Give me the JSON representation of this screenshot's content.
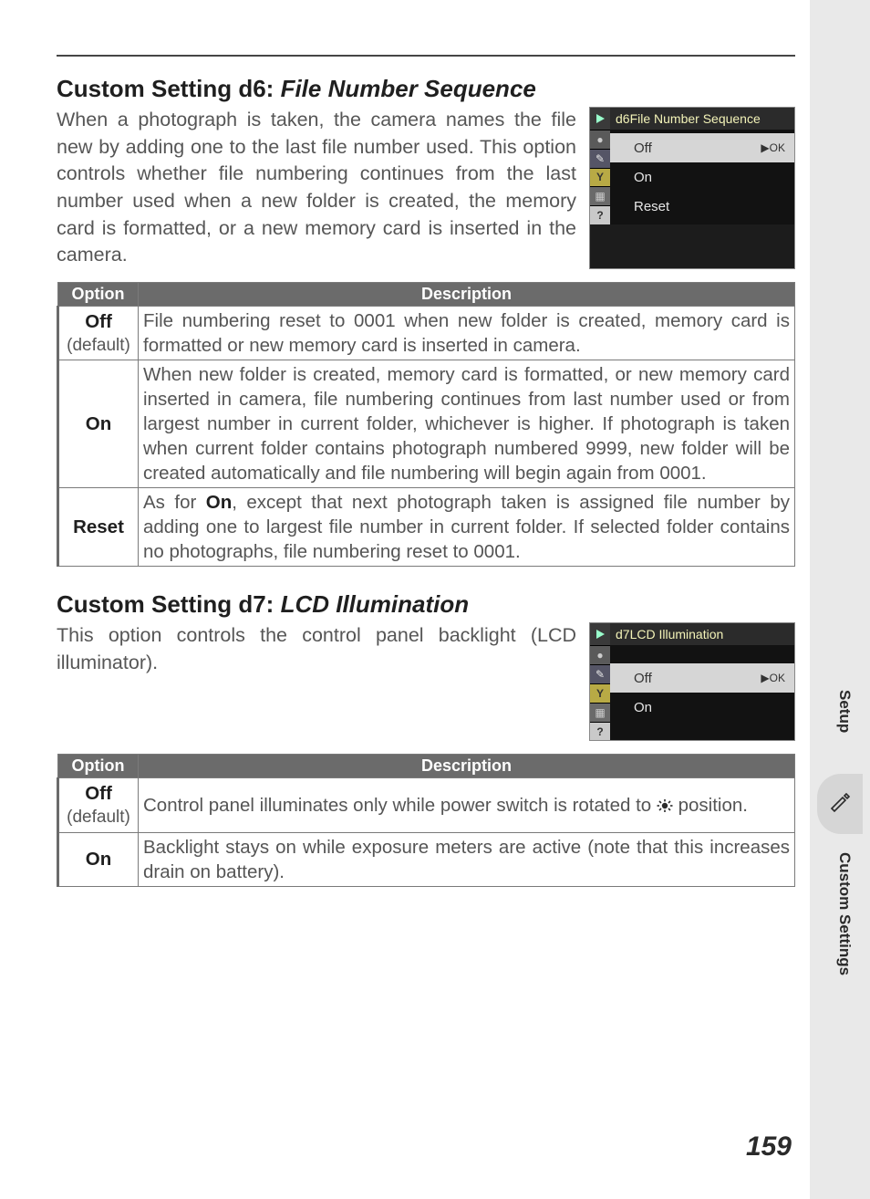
{
  "page_number": "159",
  "sidebar": {
    "setup_label": "Setup",
    "custom_label": "Custom Settings"
  },
  "d6": {
    "heading_prefix": "Custom Setting d6: ",
    "heading_italic": "File Number Sequence",
    "intro": "When a photograph is taken, the camera names the file new by adding one to the last file number used.  This option controls whether file numbering continues from the last number used when a new folder is created, the memory card is formatted, or a new memory card is inserted in the camera.",
    "lcd": {
      "title": "d6File Number Sequence",
      "rows": [
        {
          "label": "Off",
          "ok": "▶OK",
          "selected": true
        },
        {
          "label": "On",
          "selected": false
        },
        {
          "label": "Reset",
          "selected": false
        }
      ],
      "side_icons": [
        "●",
        "✎",
        "Y",
        "▦",
        "?"
      ]
    },
    "table": {
      "headers": {
        "option": "Option",
        "description": "Description"
      },
      "rows": [
        {
          "option": "Off",
          "sub": "(default)",
          "desc": "File numbering reset to 0001 when new folder is created, memory card is formatted or new memory card is inserted in camera."
        },
        {
          "option": "On",
          "desc": "When new folder is created, memory card is formatted, or new memory card inserted in camera, file numbering continues from last number used or from largest number in current folder, whichever is higher.  If photograph is taken when current folder contains photograph numbered 9999, new folder will be created automatically and file numbering will begin again from 0001."
        },
        {
          "option": "Reset",
          "desc_pre": "As for ",
          "desc_bold": "On",
          "desc_post": ", except that next photograph taken is assigned file number by adding one to largest file number in current folder.  If selected folder contains no photographs, file numbering reset to 0001."
        }
      ]
    }
  },
  "d7": {
    "heading_prefix": "Custom Setting d7: ",
    "heading_italic": "LCD Illumination",
    "intro": "This option controls the control panel backlight (LCD illuminator).",
    "lcd": {
      "title": "d7LCD Illumination",
      "rows": [
        {
          "label": "Off",
          "ok": "▶OK",
          "selected": true
        },
        {
          "label": "On",
          "selected": false
        }
      ],
      "side_icons": [
        "●",
        "✎",
        "Y",
        "▦",
        "?"
      ]
    },
    "table": {
      "headers": {
        "option": "Option",
        "description": "Description"
      },
      "rows": [
        {
          "option": "Off",
          "sub": "(default)",
          "desc_pre": "Control panel illuminates only while power switch is rotated to ",
          "desc_post": " position."
        },
        {
          "option": "On",
          "desc": "Backlight stays on while exposure meters are active (note that this increases drain on battery)."
        }
      ]
    }
  }
}
